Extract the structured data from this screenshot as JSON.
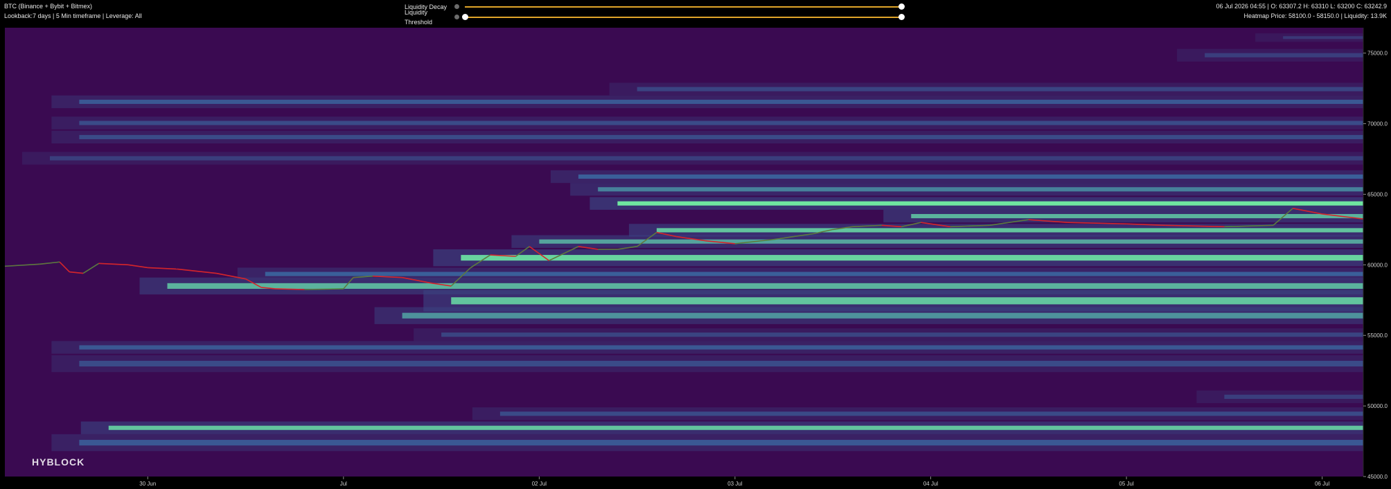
{
  "header": {
    "symbol": "BTC (Binance + Bybit + Bitmex)",
    "settings": "Lookback:7 days | 5 Min timeframe | Leverage: All",
    "ohlc": "06 Jul 2026 04:55 | O: 63307.2 H: 63310 L: 63200 C: 63242.9",
    "heatmap_info": "Heatmap Price: 58100.0 - 58150.0 | Liquidity: 13.9K"
  },
  "controls": {
    "decay_label": "Liquidity Decay",
    "decay_value": 1.0,
    "threshold_label": "Liquidity Threshold",
    "threshold_min": 0.0,
    "threshold_max": 1.0
  },
  "watermark": "HYBLOCK",
  "colors": {
    "background": "#3a0a51",
    "price_up": "#1fb34a",
    "price_down": "#e02a2a",
    "slider": "#e0a52a",
    "heat_low": "#3b0f55",
    "heat_mid": "#3a5f99",
    "heat_high": "#6fe6a0"
  },
  "chart_data": {
    "type": "heatmap",
    "title": "",
    "y_ticks": [
      "45000.0",
      "50000.0",
      "55000.0",
      "60000.0",
      "65000.0",
      "70000.0",
      "75000.0"
    ],
    "ylim": [
      45000,
      76800
    ],
    "x_ticks": [
      "30 Jun",
      "Jul",
      "02 Jul",
      "03 Jul",
      "04 Jul",
      "05 Jul",
      "06 Jul"
    ],
    "x_tick_days": [
      0,
      1,
      2,
      3,
      4,
      5,
      6
    ],
    "xlim_days": [
      -0.73,
      6.21
    ],
    "price_path": [
      [
        -0.73,
        59900
      ],
      [
        -0.55,
        60050
      ],
      [
        -0.45,
        60200
      ],
      [
        -0.4,
        59500
      ],
      [
        -0.33,
        59400
      ],
      [
        -0.25,
        60100
      ],
      [
        -0.1,
        60000
      ],
      [
        0.0,
        59800
      ],
      [
        0.15,
        59700
      ],
      [
        0.35,
        59400
      ],
      [
        0.5,
        59000
      ],
      [
        0.58,
        58400
      ],
      [
        0.65,
        58300
      ],
      [
        0.8,
        58250
      ],
      [
        1.0,
        58300
      ],
      [
        1.05,
        59100
      ],
      [
        1.15,
        59200
      ],
      [
        1.3,
        59100
      ],
      [
        1.45,
        58700
      ],
      [
        1.55,
        58500
      ],
      [
        1.65,
        59800
      ],
      [
        1.75,
        60700
      ],
      [
        1.88,
        60600
      ],
      [
        1.95,
        61300
      ],
      [
        2.05,
        60300
      ],
      [
        2.2,
        61300
      ],
      [
        2.3,
        61100
      ],
      [
        2.4,
        61100
      ],
      [
        2.5,
        61300
      ],
      [
        2.6,
        62300
      ],
      [
        2.7,
        62000
      ],
      [
        2.85,
        61700
      ],
      [
        3.0,
        61500
      ],
      [
        3.2,
        61800
      ],
      [
        3.4,
        62200
      ],
      [
        3.5,
        62500
      ],
      [
        3.6,
        62700
      ],
      [
        3.75,
        62800
      ],
      [
        3.85,
        62700
      ],
      [
        3.95,
        63000
      ],
      [
        4.1,
        62700
      ],
      [
        4.3,
        62800
      ],
      [
        4.5,
        63200
      ],
      [
        4.7,
        63000
      ],
      [
        5.0,
        62900
      ],
      [
        5.2,
        62800
      ],
      [
        5.5,
        62700
      ],
      [
        5.75,
        62800
      ],
      [
        5.85,
        64000
      ],
      [
        6.0,
        63600
      ],
      [
        6.21,
        63250
      ]
    ],
    "liquidity_bands": [
      {
        "low": 47200,
        "high": 47600,
        "intensity": 0.55,
        "start_day": -0.35
      },
      {
        "low": 48300,
        "high": 48600,
        "intensity": 0.9,
        "start_day": -0.2
      },
      {
        "low": 49300,
        "high": 49600,
        "intensity": 0.45,
        "start_day": 1.8
      },
      {
        "low": 50500,
        "high": 50800,
        "intensity": 0.35,
        "start_day": 5.5
      },
      {
        "low": 52800,
        "high": 53200,
        "intensity": 0.45,
        "start_day": -0.35
      },
      {
        "low": 54000,
        "high": 54300,
        "intensity": 0.55,
        "start_day": -0.35
      },
      {
        "low": 54900,
        "high": 55200,
        "intensity": 0.4,
        "start_day": 1.5
      },
      {
        "low": 56200,
        "high": 56600,
        "intensity": 0.75,
        "start_day": 1.3
      },
      {
        "low": 57200,
        "high": 57700,
        "intensity": 0.9,
        "start_day": 1.55
      },
      {
        "low": 58300,
        "high": 58700,
        "intensity": 0.85,
        "start_day": 0.1
      },
      {
        "low": 59200,
        "high": 59500,
        "intensity": 0.6,
        "start_day": 0.6
      },
      {
        "low": 60300,
        "high": 60700,
        "intensity": 0.95,
        "start_day": 1.6
      },
      {
        "low": 61500,
        "high": 61800,
        "intensity": 0.8,
        "start_day": 2.0
      },
      {
        "low": 62300,
        "high": 62600,
        "intensity": 0.9,
        "start_day": 2.6
      },
      {
        "low": 63300,
        "high": 63600,
        "intensity": 0.85,
        "start_day": 3.9
      },
      {
        "low": 64200,
        "high": 64500,
        "intensity": 1.0,
        "start_day": 2.4
      },
      {
        "low": 65200,
        "high": 65500,
        "intensity": 0.7,
        "start_day": 2.3
      },
      {
        "low": 66100,
        "high": 66400,
        "intensity": 0.6,
        "start_day": 2.2
      },
      {
        "low": 67400,
        "high": 67700,
        "intensity": 0.35,
        "start_day": -0.5
      },
      {
        "low": 68900,
        "high": 69200,
        "intensity": 0.45,
        "start_day": -0.35
      },
      {
        "low": 69900,
        "high": 70200,
        "intensity": 0.45,
        "start_day": -0.35
      },
      {
        "low": 71400,
        "high": 71700,
        "intensity": 0.55,
        "start_day": -0.35
      },
      {
        "low": 72300,
        "high": 72600,
        "intensity": 0.4,
        "start_day": 2.5
      },
      {
        "low": 74700,
        "high": 75000,
        "intensity": 0.35,
        "start_day": 5.4
      },
      {
        "low": 76000,
        "high": 76200,
        "intensity": 0.3,
        "start_day": 5.8
      }
    ]
  }
}
